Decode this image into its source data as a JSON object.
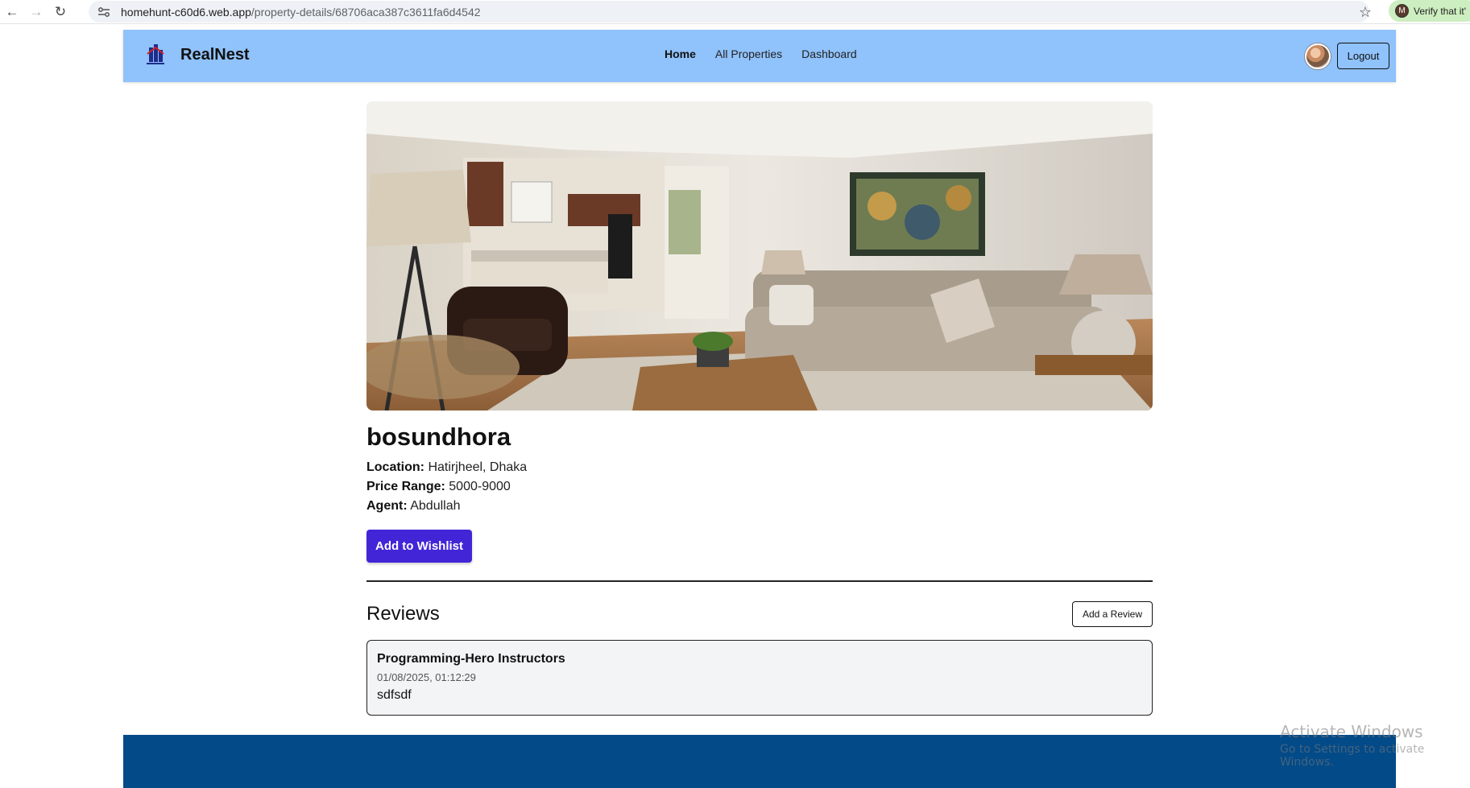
{
  "browser": {
    "url_host": "homehunt-c60d6.web.app",
    "url_path": "/property-details/68706aca387c3611fa6d4542",
    "profile_pill_label": "Verify that it'",
    "profile_initial": "M",
    "icons": [
      "back-arrow-icon",
      "forward-arrow-icon",
      "reload-icon",
      "site-info-icon",
      "star-icon"
    ]
  },
  "navbar": {
    "brand_name": "RealNest",
    "links": [
      {
        "label": "Home",
        "active": true
      },
      {
        "label": "All Properties",
        "active": false
      },
      {
        "label": "Dashboard",
        "active": false
      }
    ],
    "logout_label": "Logout",
    "background": "#90c2fb"
  },
  "property": {
    "title": "bosundhora",
    "location_label": "Location:",
    "location": "Hatirjheel, Dhaka",
    "price_label": "Price Range:",
    "price": "5000-9000",
    "agent_label": "Agent:",
    "agent": "Abdullah",
    "wishlist_button": "Add to Wishlist",
    "wishlist_color": "#4325d8"
  },
  "reviews": {
    "heading": "Reviews",
    "add_button": "Add a Review",
    "items": [
      {
        "author": "Programming-Hero Instructors",
        "date": "01/08/2025, 01:12:29",
        "text": "sdfsdf"
      }
    ]
  },
  "footer": {
    "background": "#034a88"
  },
  "watermark": {
    "title": "Activate Windows",
    "subtitle": "Go to Settings to activate Windows."
  }
}
